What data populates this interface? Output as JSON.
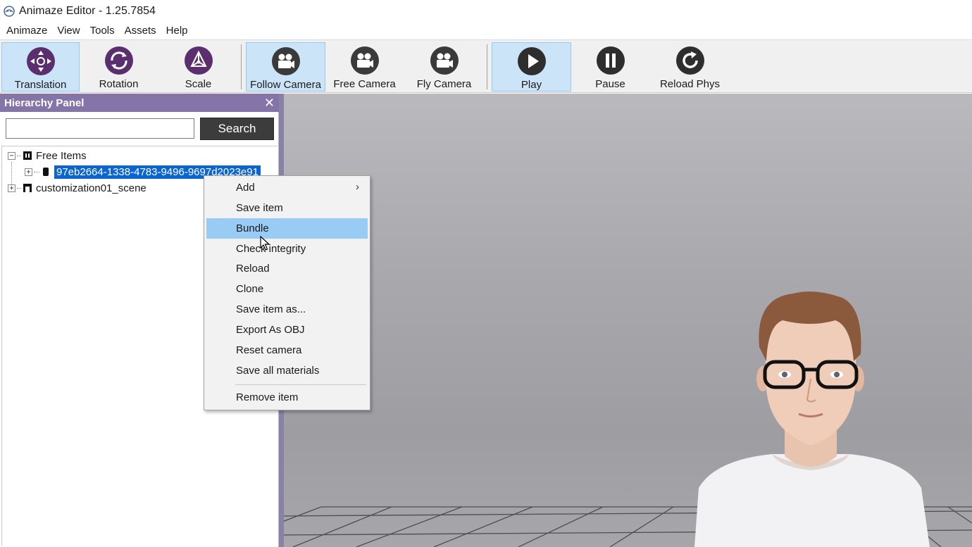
{
  "window": {
    "title": "Animaze Editor - 1.25.7854"
  },
  "menubar": {
    "items": [
      "Animaze",
      "View",
      "Tools",
      "Assets",
      "Help"
    ]
  },
  "toolbar": {
    "tools": [
      {
        "label": "Translation",
        "icon": "translation-icon",
        "active": true
      },
      {
        "label": "Rotation",
        "icon": "rotation-icon",
        "active": false
      },
      {
        "label": "Scale",
        "icon": "scale-icon",
        "active": false
      },
      {
        "label": "Follow Camera",
        "icon": "camera-icon",
        "active": true
      },
      {
        "label": "Free Camera",
        "icon": "camera-icon",
        "active": false
      },
      {
        "label": "Fly Camera",
        "icon": "camera-icon",
        "active": false
      },
      {
        "label": "Play",
        "icon": "play-icon",
        "active": true
      },
      {
        "label": "Pause",
        "icon": "pause-icon",
        "active": false
      },
      {
        "label": "Reload Phys",
        "icon": "reload-icon",
        "active": false
      }
    ]
  },
  "hierarchy": {
    "title": "Hierarchy Panel",
    "search_value": "",
    "search_button": "Search",
    "tree": {
      "free_items": "Free Items",
      "selected_item": "97eb2664-1338-4783-9496-9697d2023e91",
      "scene": "customization01_scene"
    }
  },
  "context_menu": {
    "items": [
      {
        "label": "Add",
        "submenu": true
      },
      {
        "label": "Save item"
      },
      {
        "label": "Bundle",
        "highlighted": true
      },
      {
        "label": "Check integrity"
      },
      {
        "label": "Reload"
      },
      {
        "label": "Clone"
      },
      {
        "label": "Save item as..."
      },
      {
        "label": "Export As OBJ"
      },
      {
        "label": "Reset camera"
      },
      {
        "label": "Save all materials"
      },
      {
        "label": "Remove item"
      }
    ],
    "submenu_arrow": "›"
  },
  "colors": {
    "panel_header": "#8474a8",
    "selection": "#0a64d2",
    "menu_highlight": "#99ccf5",
    "tool_icon": "#5b2e6e"
  }
}
